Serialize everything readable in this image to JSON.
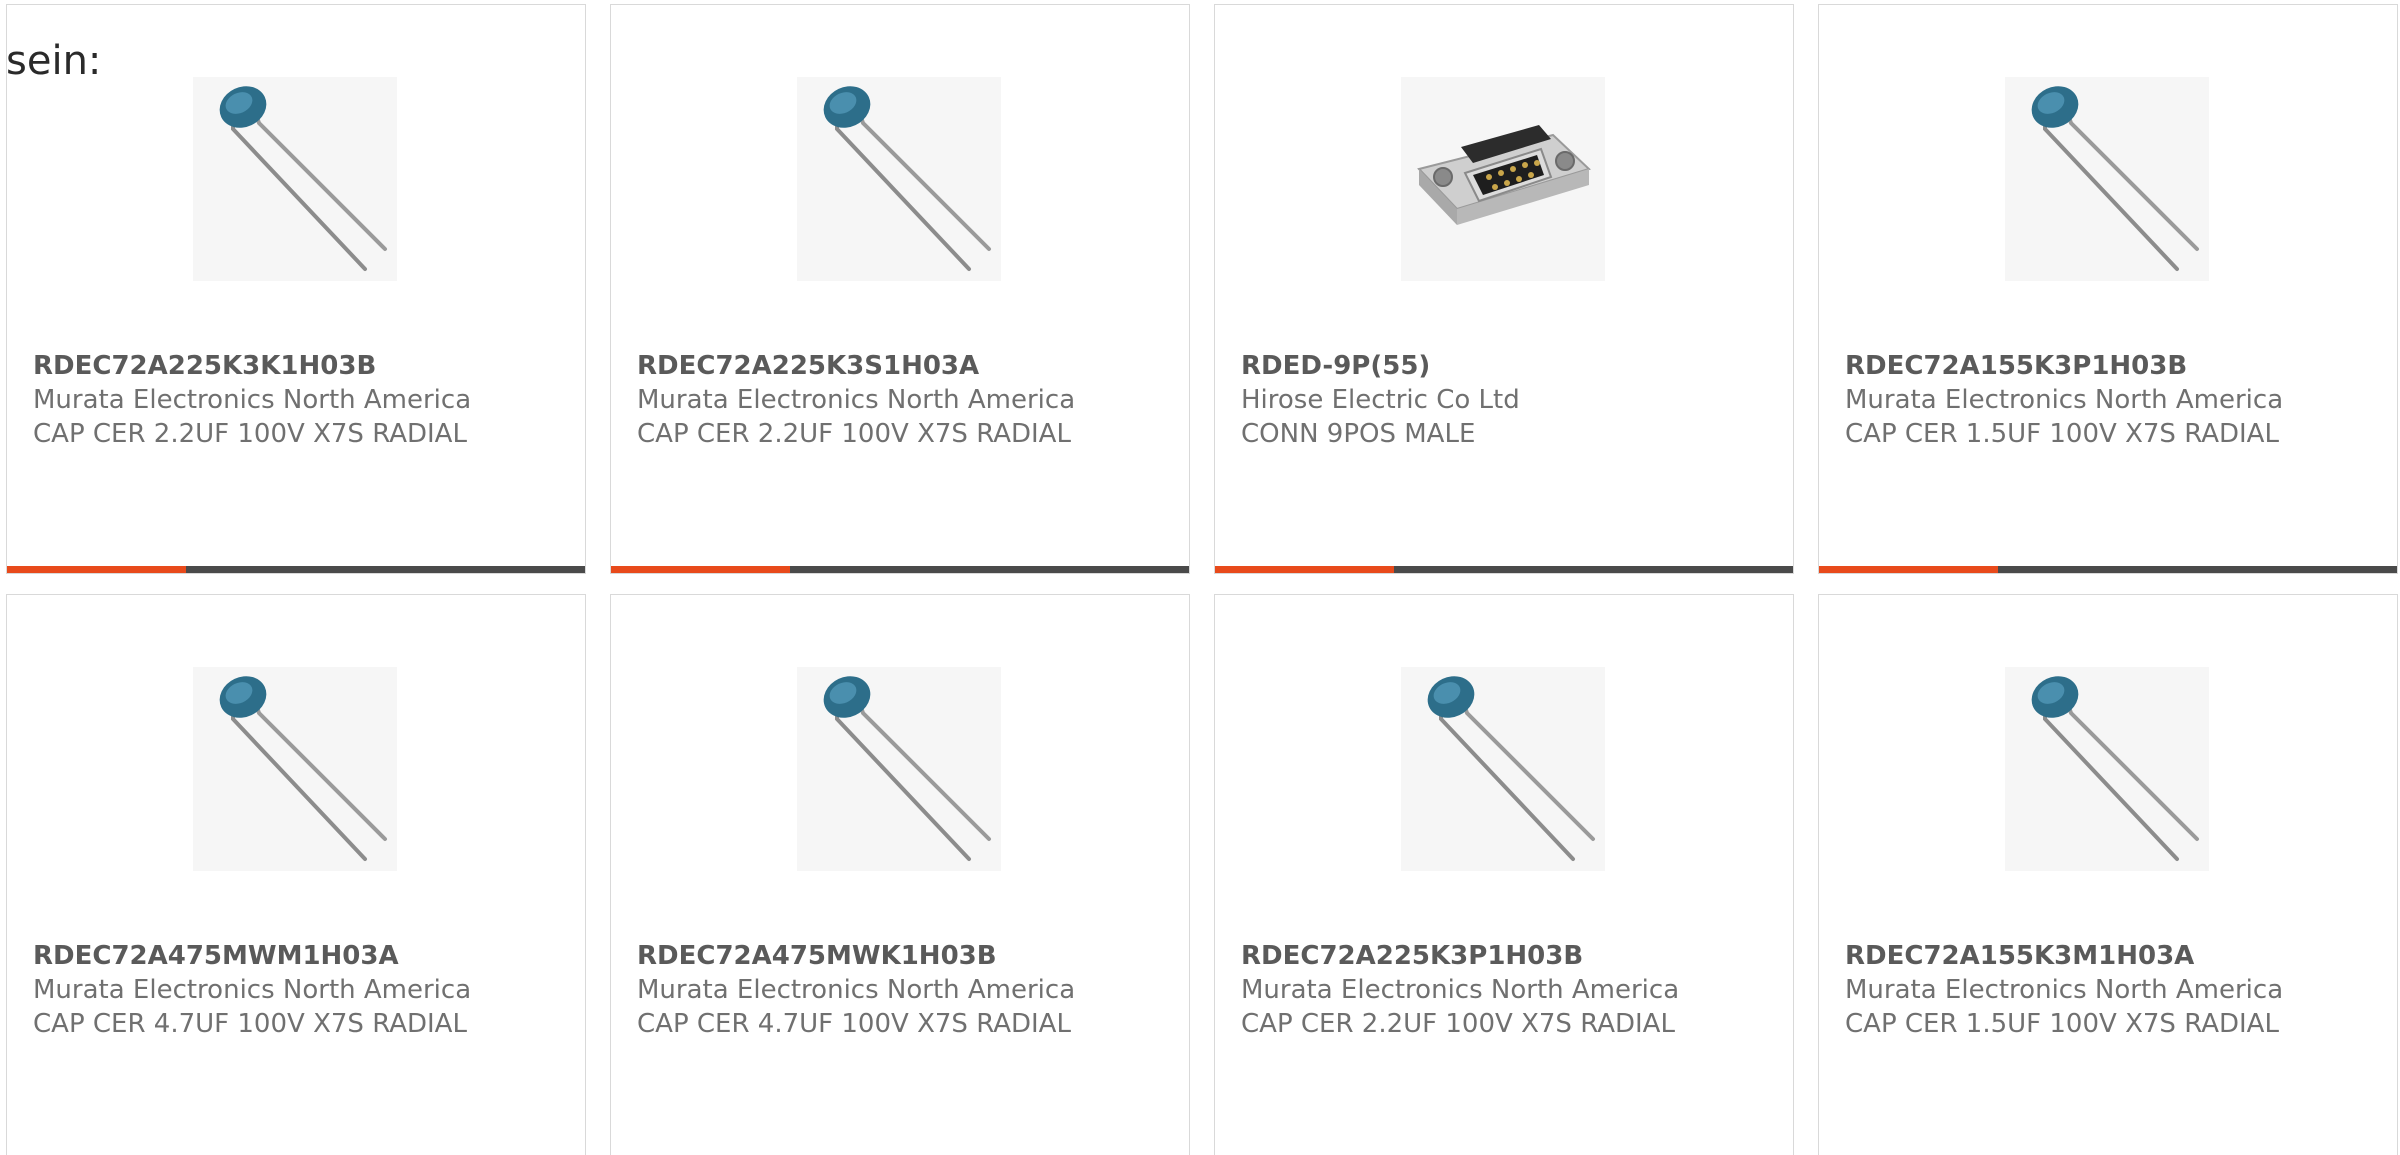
{
  "heading": "sein:",
  "colors": {
    "accent": "#e84a1b",
    "bar_track": "#4a4a4a"
  },
  "products": [
    {
      "part": "RDEC72A225K3K1H03B",
      "manufacturer": "Murata Electronics North America",
      "description": "CAP CER 2.2UF 100V X7S RADIAL",
      "image_icon": "ceramic-capacitor-icon",
      "progress": 0.31
    },
    {
      "part": "RDEC72A225K3S1H03A",
      "manufacturer": "Murata Electronics North America",
      "description": "CAP CER 2.2UF 100V X7S RADIAL",
      "image_icon": "ceramic-capacitor-icon",
      "progress": 0.31
    },
    {
      "part": "RDED-9P(55)",
      "manufacturer": "Hirose Electric Co Ltd",
      "description": "CONN 9POS MALE",
      "image_icon": "dsub-connector-icon",
      "progress": 0.31
    },
    {
      "part": "RDEC72A155K3P1H03B",
      "manufacturer": "Murata Electronics North America",
      "description": "CAP CER 1.5UF 100V X7S RADIAL",
      "image_icon": "ceramic-capacitor-icon",
      "progress": 0.31
    },
    {
      "part": "RDEC72A475MWM1H03A",
      "manufacturer": "Murata Electronics North America",
      "description": "CAP CER 4.7UF 100V X7S RADIAL",
      "image_icon": "ceramic-capacitor-icon"
    },
    {
      "part": "RDEC72A475MWK1H03B",
      "manufacturer": "Murata Electronics North America",
      "description": "CAP CER 4.7UF 100V X7S RADIAL",
      "image_icon": "ceramic-capacitor-icon"
    },
    {
      "part": "RDEC72A225K3P1H03B",
      "manufacturer": "Murata Electronics North America",
      "description": "CAP CER 2.2UF 100V X7S RADIAL",
      "image_icon": "ceramic-capacitor-icon"
    },
    {
      "part": "RDEC72A155K3M1H03A",
      "manufacturer": "Murata Electronics North America",
      "description": "CAP CER 1.5UF 100V X7S RADIAL",
      "image_icon": "ceramic-capacitor-icon"
    }
  ]
}
